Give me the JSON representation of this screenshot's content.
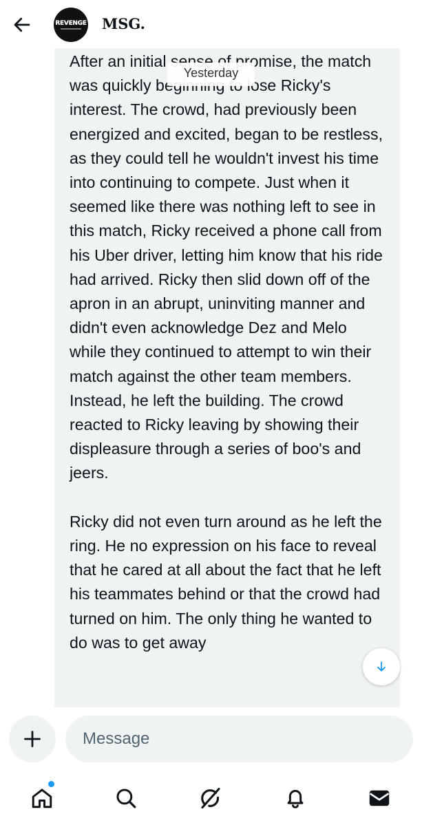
{
  "header": {
    "contact_name": "MSG.",
    "avatar_label": "REVENGE",
    "back_icon": "arrow-left-icon"
  },
  "conversation": {
    "date_separator": "Yesterday",
    "message_text": "After an initial sense of promise, the match was quickly beginning to lose Ricky's interest. The crowd, had previously been energized and excited, began to be restless, as they could tell he wouldn't invest his time into continuing to compete. Just when it seemed like there was nothing left to see in this match, Ricky received a phone call from his Uber driver, letting him know that his ride had arrived. Ricky then slid down off of the apron in an abrupt, uninviting manner and didn't even acknowledge Dez and Melo while they continued to attempt to win their match against the other team members. Instead, he left the building. The crowd reacted to Ricky leaving by showing their displeasure through a series of boo's and jeers.\n\nRicky did not even turn around as he left the ring. He no expression on his face to reveal that he cared at all about the fact that he left his teammates behind or that the crowd had turned on him. The only thing he wanted to do was to get away"
  },
  "composer": {
    "placeholder": "Message",
    "value": ""
  },
  "bottom_nav": {
    "items": [
      "home-icon",
      "search-icon",
      "grok-icon",
      "bell-icon",
      "mail-icon"
    ],
    "has_notification_dot": true
  },
  "colors": {
    "bubble_bg": "#eff3f4",
    "accent": "#1d9bf0",
    "text": "#0f1419",
    "placeholder": "#536471"
  }
}
